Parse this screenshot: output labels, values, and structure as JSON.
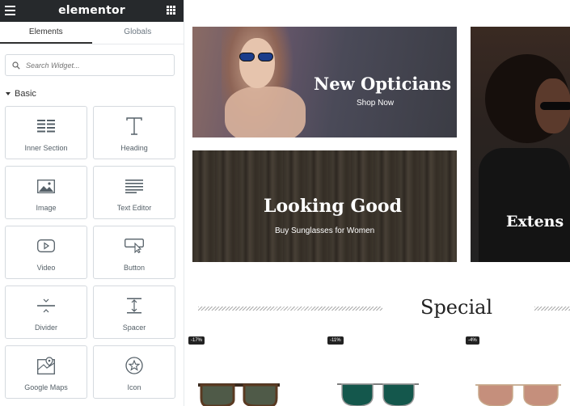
{
  "panel": {
    "brand": "elementor",
    "tabs": [
      {
        "label": "Elements",
        "active": true
      },
      {
        "label": "Globals",
        "active": false
      }
    ],
    "search": {
      "placeholder": "Search Widget..."
    },
    "category": {
      "label": "Basic"
    },
    "widgets": [
      {
        "label": "Inner Section",
        "icon": "inner-section-icon"
      },
      {
        "label": "Heading",
        "icon": "heading-icon"
      },
      {
        "label": "Image",
        "icon": "image-icon"
      },
      {
        "label": "Text Editor",
        "icon": "text-editor-icon"
      },
      {
        "label": "Video",
        "icon": "video-icon"
      },
      {
        "label": "Button",
        "icon": "button-icon"
      },
      {
        "label": "Divider",
        "icon": "divider-icon"
      },
      {
        "label": "Spacer",
        "icon": "spacer-icon"
      },
      {
        "label": "Google Maps",
        "icon": "google-maps-icon"
      },
      {
        "label": "Icon",
        "icon": "star-icon"
      }
    ],
    "colors": {
      "topbar": "#26292c",
      "icon": "#556068"
    }
  },
  "canvas": {
    "banners": [
      {
        "title": "New Opticians",
        "subtitle": "Shop Now"
      },
      {
        "title": "Looking Good",
        "subtitle": "Buy Sunglasses for Women"
      },
      {
        "title": "Extens"
      }
    ],
    "section_title": "Special",
    "discounts": [
      "-17%",
      "-11%",
      "-4%"
    ]
  }
}
